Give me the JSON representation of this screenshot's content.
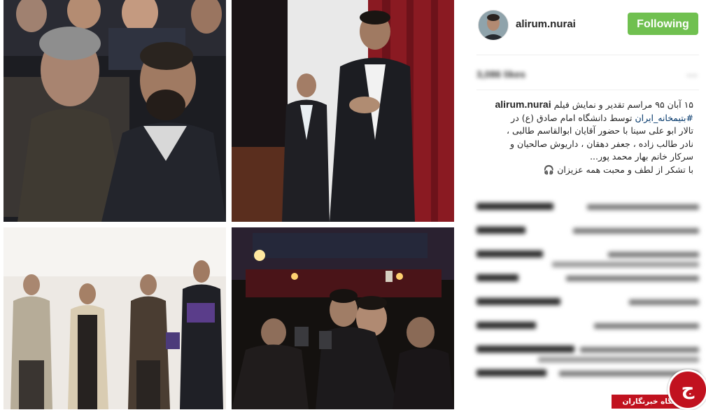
{
  "post": {
    "username": "alirum.nurai",
    "follow_label": "Following",
    "likes_text": "3,086 likes",
    "caption_user": "alirum.nurai",
    "caption_line1": "۱۵ آبان ۹۵ مراسم تقدیر و نمایش فیلم",
    "caption_hashtag": "#بتیمخانه_ایران",
    "caption_line2": "توسط دانشگاه امام صادق (ع) در",
    "caption_line3": "تالار ابو علی سینا با حضور آقایان ابوالقاسم طالبی ،",
    "caption_line4": "نادر طالب زاده ، جعفر دهقان ، داریوش صالحیان و",
    "caption_line5": "سرکار خانم بهار محمد پور...",
    "caption_line6": "با تشکر از لطف و محبت همه عزیزان 🎧"
  },
  "watermark": {
    "label": "باشگاه خبرنگاران",
    "logo_glyph": "ج"
  },
  "colors": {
    "follow_bg": "#70c050",
    "watermark_red": "#c1121f",
    "hashtag": "#003569"
  }
}
